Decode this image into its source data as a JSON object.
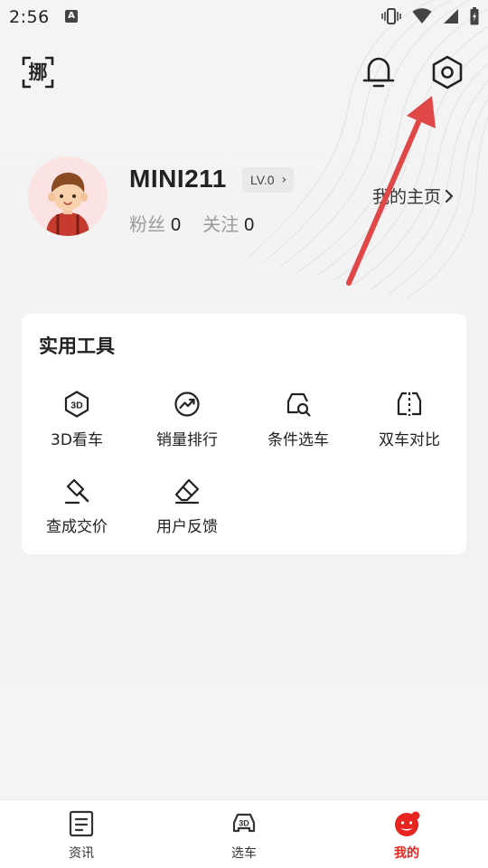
{
  "status_bar": {
    "time": "2:56",
    "notification_icon": "A",
    "icons": [
      "vibrate-icon",
      "wifi-icon",
      "signal-icon",
      "battery-icon"
    ]
  },
  "header": {
    "scan_icon_label": "挪",
    "bell_icon": "bell-icon",
    "settings_icon": "settings-hex-icon"
  },
  "profile": {
    "username": "MINI211",
    "level": "LV.0",
    "fans_label": "粉丝",
    "fans_count": "0",
    "follow_label": "关注",
    "follow_count": "0",
    "homepage_label": "我的主页"
  },
  "tools": {
    "title": "实用工具",
    "items": [
      {
        "label": "3D看车",
        "icon": "3d-badge-icon"
      },
      {
        "label": "销量排行",
        "icon": "trend-circle-icon"
      },
      {
        "label": "条件选车",
        "icon": "car-search-icon"
      },
      {
        "label": "双车对比",
        "icon": "compare-icon"
      },
      {
        "label": "查成交价",
        "icon": "gavel-icon"
      },
      {
        "label": "用户反馈",
        "icon": "eraser-icon"
      }
    ]
  },
  "bottom_nav": [
    {
      "label": "资讯",
      "icon": "news-icon",
      "active": false
    },
    {
      "label": "选车",
      "icon": "car-3d-icon",
      "active": false
    },
    {
      "label": "我的",
      "icon": "mascot-icon",
      "active": true
    }
  ],
  "colors": {
    "accent": "#e8241f",
    "annotation_arrow": "#e04848",
    "card_bg": "#ffffff",
    "page_bg": "#f3f3f4"
  }
}
